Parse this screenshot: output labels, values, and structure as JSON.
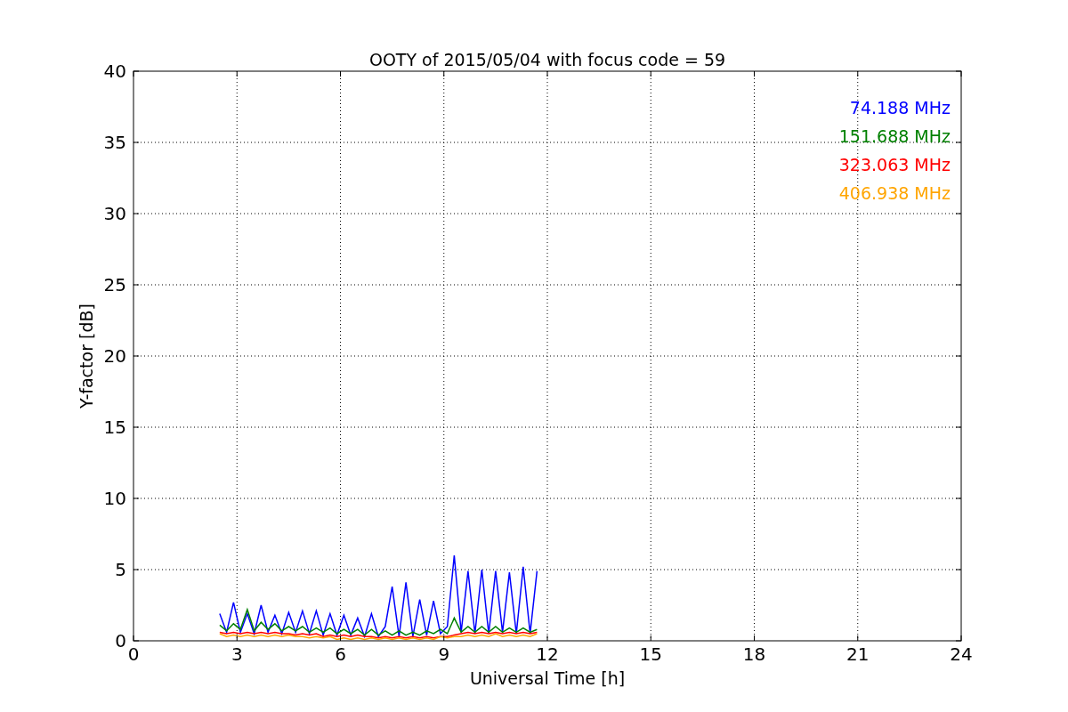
{
  "chart_data": {
    "type": "line",
    "grid": true,
    "title": "OOTY of 2015/05/04 with focus code = 59",
    "xlabel": "Universal Time [h]",
    "ylabel": "Y-factor [dB]",
    "xlim": [
      0,
      24
    ],
    "ylim": [
      0,
      40
    ],
    "xticks": [
      0,
      3,
      6,
      9,
      12,
      15,
      18,
      21,
      24
    ],
    "yticks": [
      0,
      5,
      10,
      15,
      20,
      25,
      30,
      35,
      40
    ],
    "x": [
      2.5,
      2.7,
      2.9,
      3.1,
      3.3,
      3.5,
      3.7,
      3.9,
      4.1,
      4.3,
      4.5,
      4.7,
      4.9,
      5.1,
      5.3,
      5.5,
      5.7,
      5.9,
      6.1,
      6.3,
      6.5,
      6.7,
      6.9,
      7.1,
      7.3,
      7.5,
      7.7,
      7.9,
      8.1,
      8.3,
      8.5,
      8.7,
      8.9,
      9.1,
      9.3,
      9.5,
      9.7,
      9.9,
      10.1,
      10.3,
      10.5,
      10.7,
      10.9,
      11.1,
      11.3,
      11.5,
      11.7
    ],
    "series": [
      {
        "name": "74.188 MHz",
        "color": "#0000ff",
        "values": [
          1.9,
          0.6,
          2.7,
          0.6,
          1.9,
          0.5,
          2.5,
          0.6,
          1.8,
          0.5,
          2.0,
          0.6,
          2.1,
          0.5,
          2.1,
          0.4,
          1.9,
          0.4,
          1.8,
          0.4,
          1.6,
          0.3,
          1.9,
          0.3,
          1.0,
          3.8,
          0.3,
          4.1,
          0.3,
          2.9,
          0.4,
          2.8,
          0.5,
          1.0,
          6.0,
          0.6,
          4.9,
          0.5,
          5.0,
          0.5,
          4.9,
          0.6,
          4.8,
          0.5,
          5.2,
          0.5,
          4.9
        ]
      },
      {
        "name": "151.688 MHz",
        "color": "#008000",
        "values": [
          1.1,
          0.7,
          1.2,
          0.8,
          2.2,
          0.7,
          1.3,
          0.8,
          1.2,
          0.7,
          1.0,
          0.7,
          1.0,
          0.6,
          0.9,
          0.6,
          0.9,
          0.5,
          0.8,
          0.5,
          0.8,
          0.4,
          0.8,
          0.4,
          0.7,
          0.4,
          0.7,
          0.4,
          0.6,
          0.4,
          0.7,
          0.5,
          0.8,
          0.5,
          1.6,
          0.6,
          1.0,
          0.6,
          1.0,
          0.6,
          1.0,
          0.6,
          0.9,
          0.6,
          0.9,
          0.6,
          0.8
        ]
      },
      {
        "name": "323.063 MHz",
        "color": "#ff0000",
        "values": [
          0.6,
          0.5,
          0.6,
          0.5,
          0.6,
          0.5,
          0.6,
          0.5,
          0.6,
          0.5,
          0.5,
          0.4,
          0.5,
          0.4,
          0.5,
          0.3,
          0.4,
          0.3,
          0.4,
          0.3,
          0.4,
          0.3,
          0.3,
          0.2,
          0.3,
          0.2,
          0.3,
          0.2,
          0.3,
          0.2,
          0.3,
          0.2,
          0.3,
          0.3,
          0.4,
          0.5,
          0.6,
          0.5,
          0.6,
          0.5,
          0.6,
          0.5,
          0.6,
          0.5,
          0.6,
          0.5,
          0.6
        ]
      },
      {
        "name": "406.938 MHz",
        "color": "#ffa500",
        "values": [
          0.5,
          0.3,
          0.4,
          0.3,
          0.4,
          0.3,
          0.4,
          0.3,
          0.4,
          0.3,
          0.4,
          0.3,
          0.3,
          0.2,
          0.3,
          0.2,
          0.3,
          0.1,
          0.2,
          0.1,
          0.2,
          0.1,
          0.2,
          0.1,
          0.2,
          0.1,
          0.2,
          0.1,
          0.2,
          0.1,
          0.2,
          0.1,
          0.3,
          0.2,
          0.3,
          0.3,
          0.4,
          0.3,
          0.4,
          0.3,
          0.5,
          0.3,
          0.4,
          0.3,
          0.4,
          0.3,
          0.5
        ]
      }
    ]
  }
}
